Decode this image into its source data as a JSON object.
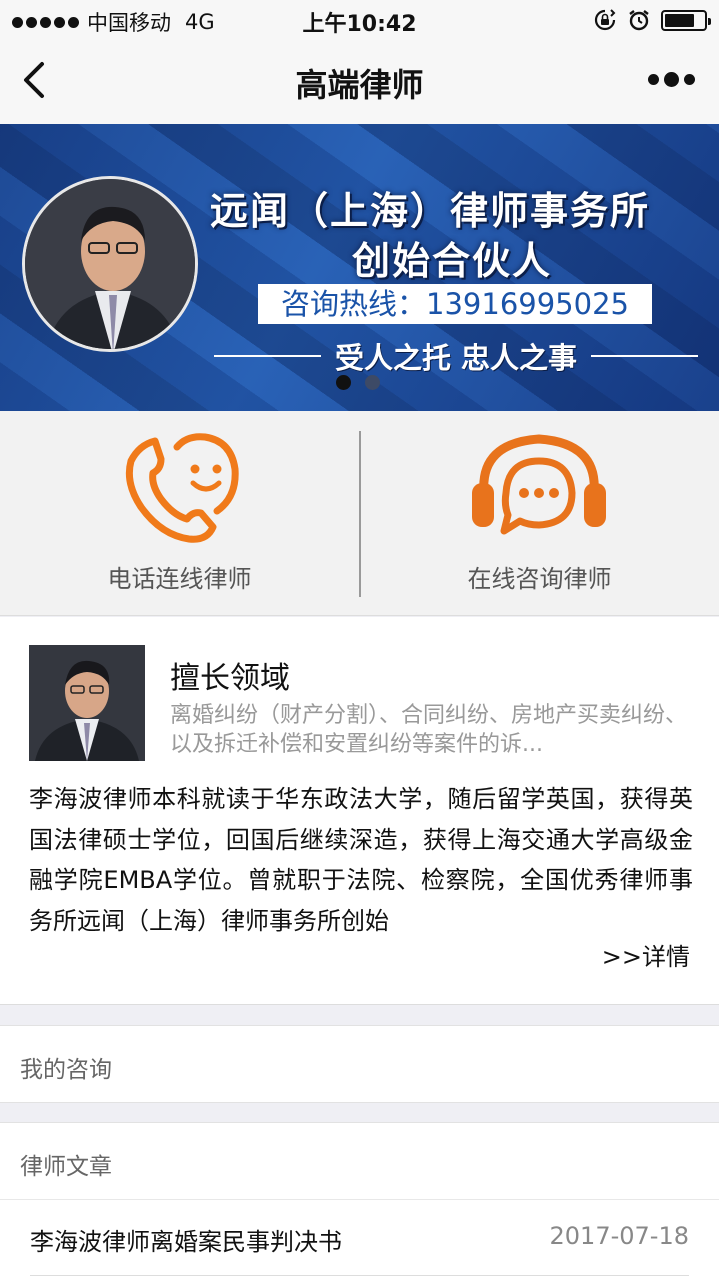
{
  "status_bar": {
    "carrier": "中国移动",
    "network": "4G",
    "time": "上午10:42"
  },
  "nav": {
    "title": "高端律师"
  },
  "banner": {
    "title_line1": "远闻（上海）律师事务所",
    "title_line2": "创始合伙人",
    "hotline": "咨询热线：13916995025",
    "slogan": "受人之托  忠人之事",
    "active_slide": 1,
    "slide_count": 2
  },
  "actions": {
    "phone_label": "电话连线律师",
    "online_label": "在线咨询律师",
    "accent_color": "#f07a1a"
  },
  "lawyer": {
    "heading": "擅长领域",
    "specialty": "离婚纠纷（财产分割）、合同纠纷、房地产买卖纠纷、以及拆迁补偿和安置纠纷等案件的诉...",
    "bio": " 李海波律师本科就读于华东政法大学，随后留学英国，获得英国法律硕士学位，回国后继续深造，获得上海交通大学高级金融学院EMBA学位。曾就职于法院、检察院，全国优秀律师事务所远闻（上海）律师事务所创始",
    "more_label": ">>详情"
  },
  "sections": {
    "my_consult": "我的咨询",
    "articles": "律师文章"
  },
  "articles": [
    {
      "title": "李海波律师离婚案民事判决书",
      "date": "2017-07-18"
    }
  ]
}
